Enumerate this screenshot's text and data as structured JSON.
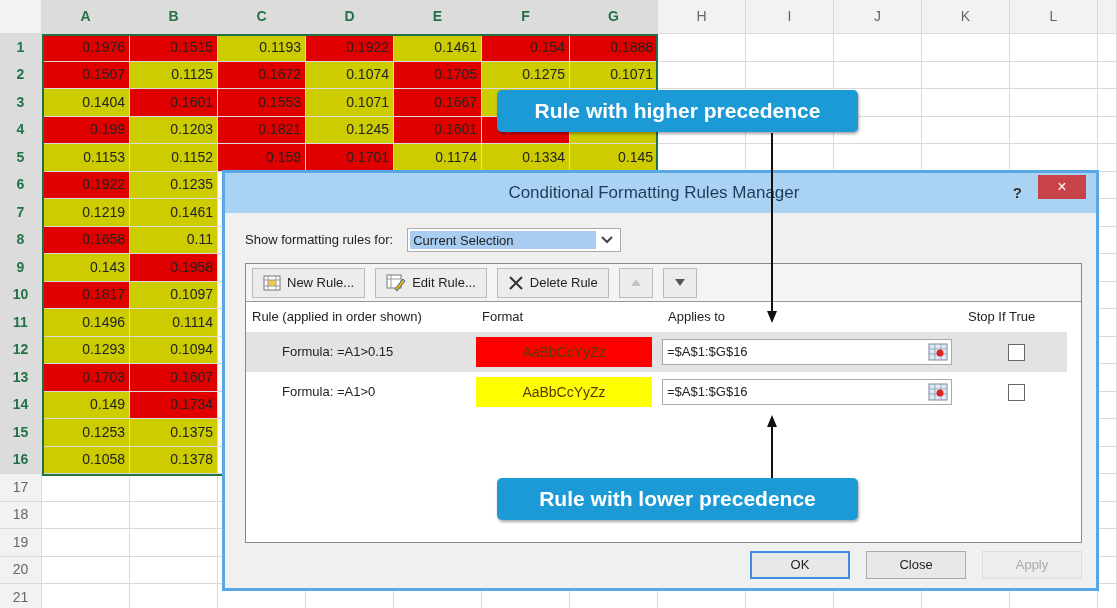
{
  "sheet": {
    "columns": [
      {
        "label": "A",
        "selected": true
      },
      {
        "label": "B",
        "selected": true
      },
      {
        "label": "C",
        "selected": true
      },
      {
        "label": "D",
        "selected": true
      },
      {
        "label": "E",
        "selected": true
      },
      {
        "label": "F",
        "selected": true
      },
      {
        "label": "G",
        "selected": true
      },
      {
        "label": "H",
        "selected": false
      },
      {
        "label": "I",
        "selected": false
      },
      {
        "label": "J",
        "selected": false
      },
      {
        "label": "K",
        "selected": false
      },
      {
        "label": "L",
        "selected": false
      }
    ],
    "rows": [
      {
        "label": "1",
        "selected": true,
        "cells": [
          {
            "value": "0.1976",
            "color": "#e00000"
          },
          {
            "value": "0.1515",
            "color": "#e00000"
          },
          {
            "value": "0.1193",
            "color": "#cccc00"
          },
          {
            "value": "0.1922",
            "color": "#e00000"
          },
          {
            "value": "0.1461",
            "color": "#cccc00"
          },
          {
            "value": "0.154",
            "color": "#e00000"
          },
          {
            "value": "0.1888",
            "color": "#e00000"
          }
        ]
      },
      {
        "label": "2",
        "selected": true,
        "cells": [
          {
            "value": "0.1507",
            "color": "#e00000"
          },
          {
            "value": "0.1125",
            "color": "#cccc00"
          },
          {
            "value": "0.1672",
            "color": "#e00000"
          },
          {
            "value": "0.1074",
            "color": "#cccc00"
          },
          {
            "value": "0.1705",
            "color": "#e00000"
          },
          {
            "value": "0.1275",
            "color": "#cccc00"
          },
          {
            "value": "0.1071",
            "color": "#cccc00"
          }
        ]
      },
      {
        "label": "3",
        "selected": true,
        "cells": [
          {
            "value": "0.1404",
            "color": "#cccc00"
          },
          {
            "value": "0.1601",
            "color": "#e00000"
          },
          {
            "value": "0.1553",
            "color": "#e00000"
          },
          {
            "value": "0.1071",
            "color": "#cccc00"
          },
          {
            "value": "0.1667",
            "color": "#e00000"
          },
          {
            "color": "#cccc00"
          },
          {
            "color": "#cccc00"
          }
        ]
      },
      {
        "label": "4",
        "selected": true,
        "cells": [
          {
            "value": "0.199",
            "color": "#e00000"
          },
          {
            "value": "0.1203",
            "color": "#cccc00"
          },
          {
            "value": "0.1821",
            "color": "#e00000"
          },
          {
            "value": "0.1245",
            "color": "#cccc00"
          },
          {
            "value": "0.1601",
            "color": "#e00000"
          },
          {
            "color": "#e00000"
          },
          {
            "color": "#cccc00"
          }
        ]
      },
      {
        "label": "5",
        "selected": true,
        "cells": [
          {
            "value": "0.1153",
            "color": "#cccc00"
          },
          {
            "value": "0.1152",
            "color": "#cccc00"
          },
          {
            "value": "0.159",
            "color": "#e00000"
          },
          {
            "value": "0.1701",
            "color": "#e00000"
          },
          {
            "value": "0.1174",
            "color": "#cccc00"
          },
          {
            "value": "0.1334",
            "color": "#cccc00"
          },
          {
            "value": "0.145",
            "color": "#cccc00"
          }
        ]
      },
      {
        "label": "6",
        "selected": true,
        "cells": [
          {
            "value": "0.1922",
            "color": "#e00000"
          },
          {
            "value": "0.1235",
            "color": "#cccc00"
          }
        ]
      },
      {
        "label": "7",
        "selected": true,
        "cells": [
          {
            "value": "0.1219",
            "color": "#cccc00"
          },
          {
            "value": "0.1461",
            "color": "#cccc00"
          }
        ]
      },
      {
        "label": "8",
        "selected": true,
        "cells": [
          {
            "value": "0.1658",
            "color": "#e00000"
          },
          {
            "value": "0.11",
            "color": "#cccc00"
          }
        ]
      },
      {
        "label": "9",
        "selected": true,
        "cells": [
          {
            "value": "0.143",
            "color": "#cccc00"
          },
          {
            "value": "0.1958",
            "color": "#e00000"
          }
        ]
      },
      {
        "label": "10",
        "selected": true,
        "cells": [
          {
            "value": "0.1817",
            "color": "#e00000"
          },
          {
            "value": "0.1097",
            "color": "#cccc00"
          }
        ]
      },
      {
        "label": "11",
        "selected": true,
        "cells": [
          {
            "value": "0.1496",
            "color": "#cccc00"
          },
          {
            "value": "0.1114",
            "color": "#cccc00"
          }
        ]
      },
      {
        "label": "12",
        "selected": true,
        "cells": [
          {
            "value": "0.1293",
            "color": "#cccc00"
          },
          {
            "value": "0.1094",
            "color": "#cccc00"
          }
        ]
      },
      {
        "label": "13",
        "selected": true,
        "cells": [
          {
            "value": "0.1703",
            "color": "#e00000"
          },
          {
            "value": "0.1607",
            "color": "#e00000"
          }
        ]
      },
      {
        "label": "14",
        "selected": true,
        "cells": [
          {
            "value": "0.149",
            "color": "#cccc00"
          },
          {
            "value": "0.1734",
            "color": "#e00000"
          }
        ]
      },
      {
        "label": "15",
        "selected": true,
        "cells": [
          {
            "value": "0.1253",
            "color": "#cccc00"
          },
          {
            "value": "0.1375",
            "color": "#cccc00"
          }
        ]
      },
      {
        "label": "16",
        "selected": true,
        "cells": [
          {
            "value": "0.1058",
            "color": "#cccc00"
          },
          {
            "value": "0.1378",
            "color": "#cccc00"
          }
        ]
      },
      {
        "label": "17",
        "selected": false,
        "cells": []
      },
      {
        "label": "18",
        "selected": false,
        "cells": []
      },
      {
        "label": "19",
        "selected": false,
        "cells": []
      },
      {
        "label": "20",
        "selected": false,
        "cells": []
      },
      {
        "label": "21",
        "selected": false,
        "cells": []
      }
    ]
  },
  "dialog": {
    "title": "Conditional Formatting Rules Manager",
    "help": "?",
    "close": "×",
    "show_label": "Show formatting rules for:",
    "scope": "Current Selection",
    "toolbar": [
      {
        "kind": "new",
        "label": "New Rule...",
        "disabled": false
      },
      {
        "kind": "edit",
        "label": "Edit Rule...",
        "disabled": false
      },
      {
        "kind": "delete",
        "label": "Delete Rule",
        "disabled": false
      },
      {
        "kind": "up",
        "disabled": true
      },
      {
        "kind": "down",
        "disabled": false
      }
    ],
    "columns": [
      "Rule (applied in order shown)",
      "Format",
      "Applies to",
      "Stop If True"
    ],
    "rules": [
      {
        "rule": "Formula: =A1>0.15",
        "format": "AaBbCcYyZz",
        "color": "#ff0000",
        "applies_to": "=$A$1:$G$16",
        "stop_if_true": false,
        "selected": true
      },
      {
        "rule": "Formula: =A1>0",
        "format": "AaBbCcYyZz",
        "color": "#ffff00",
        "applies_to": "=$A$1:$G$16",
        "stop_if_true": false,
        "selected": false
      }
    ],
    "buttons": [
      {
        "label": "OK",
        "default": true,
        "disabled": false
      },
      {
        "label": "Close",
        "default": false,
        "disabled": false
      },
      {
        "label": "Apply",
        "default": false,
        "disabled": true
      }
    ]
  },
  "callouts": [
    {
      "text": "Rule with higher precedence",
      "kind": "down"
    },
    {
      "text": "Rule with lower precedence",
      "kind": "up"
    }
  ]
}
